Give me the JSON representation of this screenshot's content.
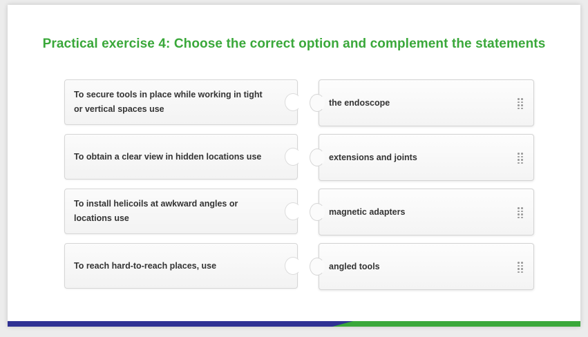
{
  "title": "Practical exercise 4: Choose the correct option and complement the statements",
  "statements": [
    "To secure tools in place while working in tight or vertical spaces use",
    "To obtain a clear view in hidden locations use",
    "To install helicoils at awkward angles or locations use",
    "To reach hard-to-reach places, use"
  ],
  "options": [
    "the endoscope",
    "extensions and joints",
    "magnetic adapters",
    "angled tools"
  ],
  "colors": {
    "title": "#3aa83a",
    "footer_left": "#2f3193",
    "footer_right": "#3aa83a"
  },
  "icons": {
    "drag_handle": "drag-handle-icon"
  }
}
